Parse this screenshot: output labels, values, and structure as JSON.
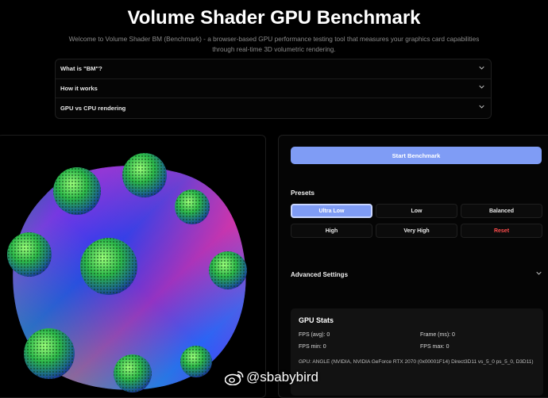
{
  "header": {
    "title": "Volume Shader GPU Benchmark",
    "subtitle": "Welcome to Volume Shader BM (Benchmark) - a browser-based GPU performance testing tool that measures your graphics card capabilities through real-time 3D volumetric rendering."
  },
  "faq": [
    {
      "label": "What is \"BM\"?",
      "icon": "chevron-down-icon"
    },
    {
      "label": "How it works",
      "icon": "chevron-down-icon"
    },
    {
      "label": "GPU vs CPU rendering",
      "icon": "chevron-down-icon"
    }
  ],
  "controls": {
    "start_label": "Start Benchmark",
    "presets_label": "Presets",
    "presets": [
      {
        "label": "Ultra Low",
        "active": true
      },
      {
        "label": "Low",
        "active": false
      },
      {
        "label": "Balanced",
        "active": false
      },
      {
        "label": "High",
        "active": false
      },
      {
        "label": "Very High",
        "active": false
      },
      {
        "label": "Reset",
        "active": false
      }
    ],
    "advanced_label": "Advanced Settings"
  },
  "stats": {
    "title": "GPU Stats",
    "fps_avg": "FPS (avg): 0",
    "frame_ms": "Frame (ms): 0",
    "fps_min": "FPS min: 0",
    "fps_max": "FPS max: 0",
    "gpu": "GPU: ANGLE (NVIDIA, NVIDIA GeForce RTX 2070 (0x00001F14) Direct3D11 vs_5_0 ps_5_0, D3D11)"
  },
  "watermark": {
    "text": "@sbabybird",
    "icon": "weibo-logo-icon"
  },
  "colors": {
    "accent": "#7f9cf5",
    "reset": "#ff4d4d",
    "background": "#000000"
  }
}
